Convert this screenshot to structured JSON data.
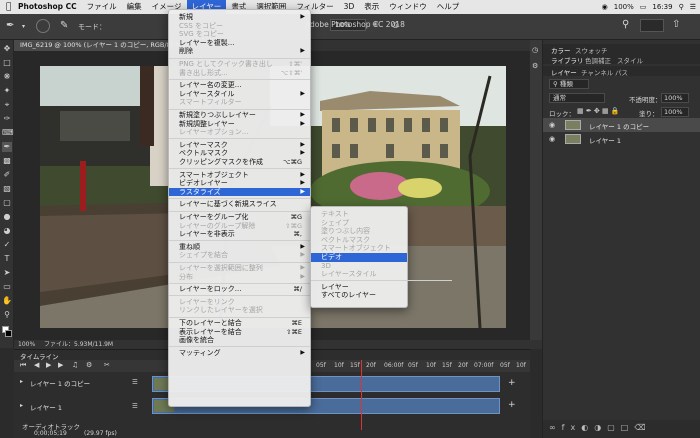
{
  "menubar": {
    "app_name": "Photoshop CC",
    "items": [
      "ファイル",
      "編集",
      "イメージ",
      "レイヤー",
      "書式",
      "選択範囲",
      "フィルター",
      "3D",
      "表示",
      "ウィンドウ",
      "ヘルプ"
    ],
    "active_item": "レイヤー",
    "battery": "100%",
    "clock": "16:39"
  },
  "options_bar": {
    "mode_label": "モード：",
    "opacity_value": "10%",
    "flow_value": "10%"
  },
  "app_title": "Adobe Photoshop CC 2018",
  "document_tab": "IMG_6219 @ 100% (レイヤー 1 のコピー, RGB/8) *",
  "status": {
    "zoom": "100%",
    "file_info": "ファイル：5.93M/11.9M"
  },
  "layer_menu": {
    "rows": [
      {
        "label": "新規",
        "arrow": true
      },
      {
        "label": "CSS をコピー",
        "disabled": true
      },
      {
        "label": "SVG をコピー",
        "disabled": true
      },
      {
        "label": "レイヤーを複製..."
      },
      {
        "label": "削除",
        "arrow": true
      },
      {
        "sep": true
      },
      {
        "label": "PNG としてクイック書き出し",
        "shortcut": "⇧⌘'",
        "disabled": true
      },
      {
        "label": "書き出し形式...",
        "shortcut": "⌥⇧⌘'",
        "disabled": true
      },
      {
        "sep": true
      },
      {
        "label": "レイヤー名の変更..."
      },
      {
        "label": "レイヤースタイル",
        "arrow": true
      },
      {
        "label": "スマートフィルター",
        "disabled": true
      },
      {
        "sep": true
      },
      {
        "label": "新規塗りつぶしレイヤー",
        "arrow": true
      },
      {
        "label": "新規調整レイヤー",
        "arrow": true
      },
      {
        "label": "レイヤーオプション...",
        "disabled": true
      },
      {
        "sep": true
      },
      {
        "label": "レイヤーマスク",
        "arrow": true
      },
      {
        "label": "ベクトルマスク",
        "arrow": true
      },
      {
        "label": "クリッピングマスクを作成",
        "shortcut": "⌥⌘G"
      },
      {
        "sep": true
      },
      {
        "label": "スマートオブジェクト",
        "arrow": true
      },
      {
        "label": "ビデオレイヤー",
        "arrow": true
      },
      {
        "label": "ラスタライズ",
        "arrow": true,
        "highlight": true
      },
      {
        "sep": true
      },
      {
        "label": "レイヤーに基づく新規スライス"
      },
      {
        "sep": true
      },
      {
        "label": "レイヤーをグループ化",
        "shortcut": "⌘G"
      },
      {
        "label": "レイヤーのグループ解除",
        "shortcut": "⇧⌘G",
        "disabled": true
      },
      {
        "label": "レイヤーを非表示",
        "shortcut": "⌘,"
      },
      {
        "sep": true
      },
      {
        "label": "重ね順",
        "arrow": true
      },
      {
        "label": "シェイプを結合",
        "arrow": true,
        "disabled": true
      },
      {
        "sep": true
      },
      {
        "label": "レイヤーを選択範囲に整列",
        "arrow": true,
        "disabled": true
      },
      {
        "label": "分布",
        "arrow": true,
        "disabled": true
      },
      {
        "sep": true
      },
      {
        "label": "レイヤーをロック...",
        "shortcut": "⌘/"
      },
      {
        "sep": true
      },
      {
        "label": "レイヤーをリンク",
        "disabled": true
      },
      {
        "label": "リンクしたレイヤーを選択",
        "disabled": true
      },
      {
        "sep": true
      },
      {
        "label": "下のレイヤーと結合",
        "shortcut": "⌘E"
      },
      {
        "label": "表示レイヤーを結合",
        "shortcut": "⇧⌘E"
      },
      {
        "label": "画像を統合"
      },
      {
        "sep": true
      },
      {
        "label": "マッティング",
        "arrow": true
      }
    ]
  },
  "rasterize_submenu": {
    "rows": [
      {
        "label": "テキスト",
        "disabled": true
      },
      {
        "label": "シェイプ",
        "disabled": true
      },
      {
        "label": "塗りつぶし内容",
        "disabled": true
      },
      {
        "label": "ベクトルマスク",
        "disabled": true
      },
      {
        "label": "スマートオブジェクト",
        "disabled": true
      },
      {
        "label": "ビデオ",
        "highlight": true
      },
      {
        "label": "3D",
        "disabled": true
      },
      {
        "label": "レイヤースタイル",
        "disabled": true
      },
      {
        "sep": true
      },
      {
        "label": "レイヤー"
      },
      {
        "label": "すべてのレイヤー"
      }
    ]
  },
  "panels": {
    "color_tabs": [
      "カラー",
      "スウォッチ"
    ],
    "library_tabs": [
      "ライブラリ",
      "色調補正",
      "スタイル"
    ],
    "layer_tabs": [
      "レイヤー",
      "チャンネル",
      "パス"
    ],
    "filter_label": "種類",
    "blend_mode": "通常",
    "opacity_label": "不透明度：",
    "opacity_value": "100%",
    "lock_label": "ロック：",
    "fill_label": "塗り：",
    "fill_value": "100%",
    "layers": [
      "レイヤー 1 のコピー",
      "レイヤー 1"
    ]
  },
  "timeline": {
    "title": "タイムライン",
    "tracks": [
      "レイヤー 1 のコピー",
      "レイヤー 1"
    ],
    "audio_track": "オーディオトラック",
    "timecode": "0;00;05;19",
    "fps": "(29.97 fps)",
    "ruler_labels": [
      "05f",
      "10f",
      "15f",
      "20f",
      "06:00f",
      "05f",
      "10f",
      "15f",
      "20f",
      "07:00f",
      "05f",
      "10f"
    ]
  },
  "colors": {
    "accent": "#2f66d6",
    "ui_dark": "#2b2b2b",
    "clip": "#4a6c9a"
  }
}
